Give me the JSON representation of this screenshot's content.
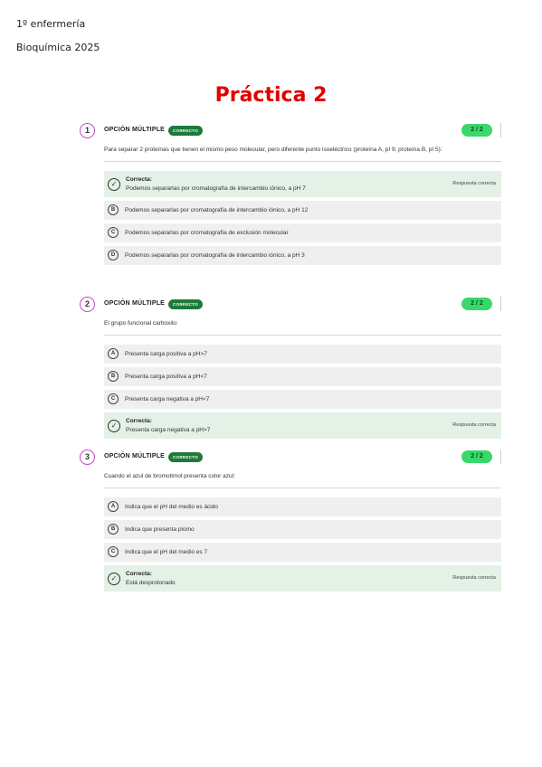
{
  "header": {
    "line1": "1º enfermería",
    "line2": "Bioquímica 2025"
  },
  "title": "Práctica 2",
  "questions": [
    {
      "number": "1",
      "type": "OPCIÓN MÚLTIPLE",
      "badge": "CORRECTO",
      "score": "2 / 2",
      "text": "Para separar 2 proteínas que tienen el mismo peso molecular, pero diferente punto isoeléctrico (proteína A, pI 9; proteína B, pI 5):",
      "options": [
        {
          "kind": "correct",
          "label": "Correcta:",
          "text": "Podemos separarlas por cromatografía de intercambio iónico, a pH 7",
          "resp": "Respuesta correcta"
        },
        {
          "kind": "letter",
          "letter": "B",
          "text": "Podemos separarlas por cromatografía de intercambio iónico, a pH 12"
        },
        {
          "kind": "letter",
          "letter": "C",
          "text": "Podemos separarlas por cromatografía de exclusión molecular"
        },
        {
          "kind": "letter",
          "letter": "D",
          "text": "Podemos separarlas por cromatografía de intercambio iónico, a pH 3"
        }
      ]
    },
    {
      "number": "2",
      "type": "OPCIÓN MÚLTIPLE",
      "badge": "CORRECTO",
      "score": "2 / 2",
      "text": "El grupo funcional carboxilo:",
      "options": [
        {
          "kind": "letter",
          "letter": "A",
          "text": "Presenta carga positiva a pH>7"
        },
        {
          "kind": "letter",
          "letter": "B",
          "text": "Presenta carga positiva a pH<7"
        },
        {
          "kind": "letter",
          "letter": "C",
          "text": "Presenta carga negativa a pH<7"
        },
        {
          "kind": "correct",
          "label": "Correcta:",
          "text": "Presenta carga negativa a pH>7",
          "resp": "Respuesta correcta"
        }
      ]
    },
    {
      "number": "3",
      "type": "OPCIÓN MÚLTIPLE",
      "badge": "CORRECTO",
      "score": "2 / 2",
      "text": "Cuando el azul de bromotimol presenta color azul:",
      "options": [
        {
          "kind": "letter",
          "letter": "A",
          "text": "Indica que el pH del medio es ácido"
        },
        {
          "kind": "letter",
          "letter": "B",
          "text": "Indica que presenta plomo"
        },
        {
          "kind": "letter",
          "letter": "C",
          "text": "Indica que el pH del medio es 7"
        },
        {
          "kind": "correct",
          "label": "Correcta:",
          "text": "Está desprotonado",
          "resp": "Respuesta correcta"
        }
      ]
    }
  ]
}
